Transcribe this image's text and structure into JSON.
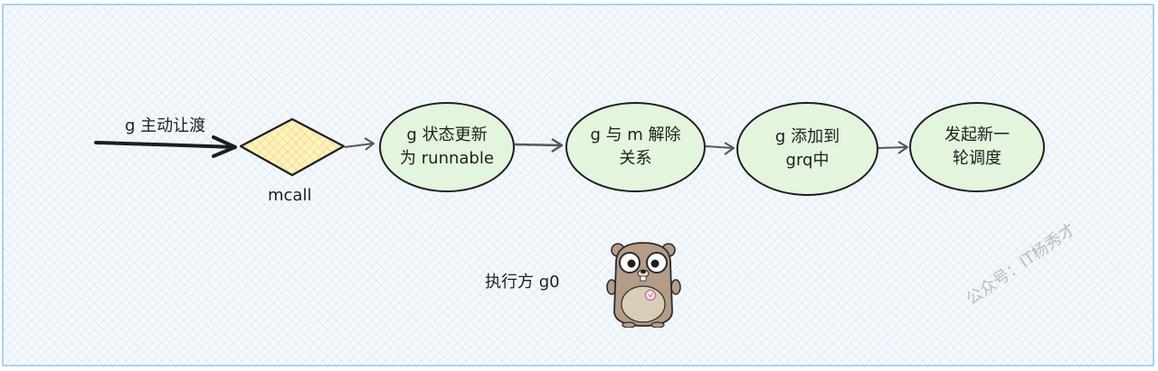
{
  "diagram": {
    "entry_label": "g 主动让渡",
    "mcall_label": "mcall",
    "nodes": [
      {
        "lines": [
          "g 状态更新",
          "为 runnable"
        ]
      },
      {
        "lines": [
          "g 与 m 解除",
          "关系"
        ]
      },
      {
        "lines": [
          "g 添加到",
          "grq中"
        ]
      },
      {
        "lines": [
          "发起新一",
          "轮调度"
        ]
      }
    ],
    "executor_label": "执行方 g0",
    "watermark": "公众号：IT杨秀才"
  },
  "colors": {
    "node_fill": "#e3f5dd",
    "diamond_fill": "#fff3bf",
    "stroke": "#1e1e1e",
    "border": "#a9d3f0",
    "gopher_body": "#b49c88"
  },
  "icons": {
    "mascot": "go-gopher-icon"
  }
}
